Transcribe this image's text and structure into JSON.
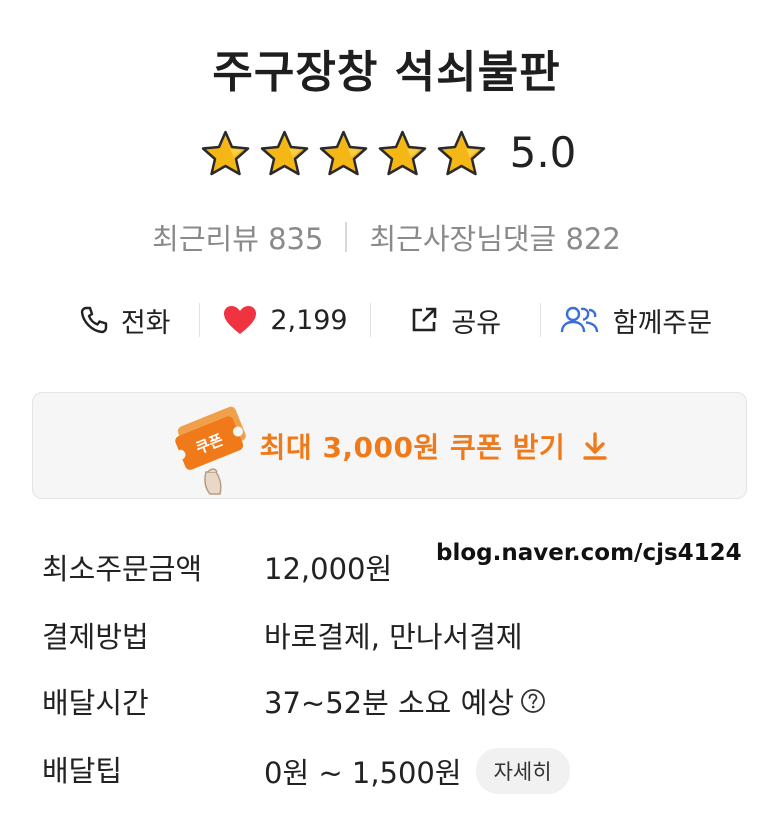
{
  "store": {
    "name": "주구장창 석쇠불판",
    "rating": 5.0,
    "rating_text": "5.0",
    "star_color": "#f5b716"
  },
  "reviews": {
    "recent_reviews": "최근리뷰 835",
    "owner_replies": "최근사장님댓글 822"
  },
  "actions": {
    "call": "전화",
    "likes": "2,199",
    "share": "공유",
    "group_order": "함께주문"
  },
  "coupon": {
    "text": "최대 3,000원 쿠폰 받기",
    "icon_label": "쿠폰",
    "accent": "#f07a1a"
  },
  "watermark": "blog.naver.com/cjs4124",
  "info": {
    "min_order_label": "최소주문금액",
    "min_order_value": "12,000원",
    "payment_label": "결제방법",
    "payment_value": "바로결제, 만나서결제",
    "delivery_time_label": "배달시간",
    "delivery_time_value": "37~52분 소요 예상",
    "delivery_tip_label": "배달팁",
    "delivery_tip_value": "0원 ~ 1,500원",
    "detail_button": "자세히"
  }
}
